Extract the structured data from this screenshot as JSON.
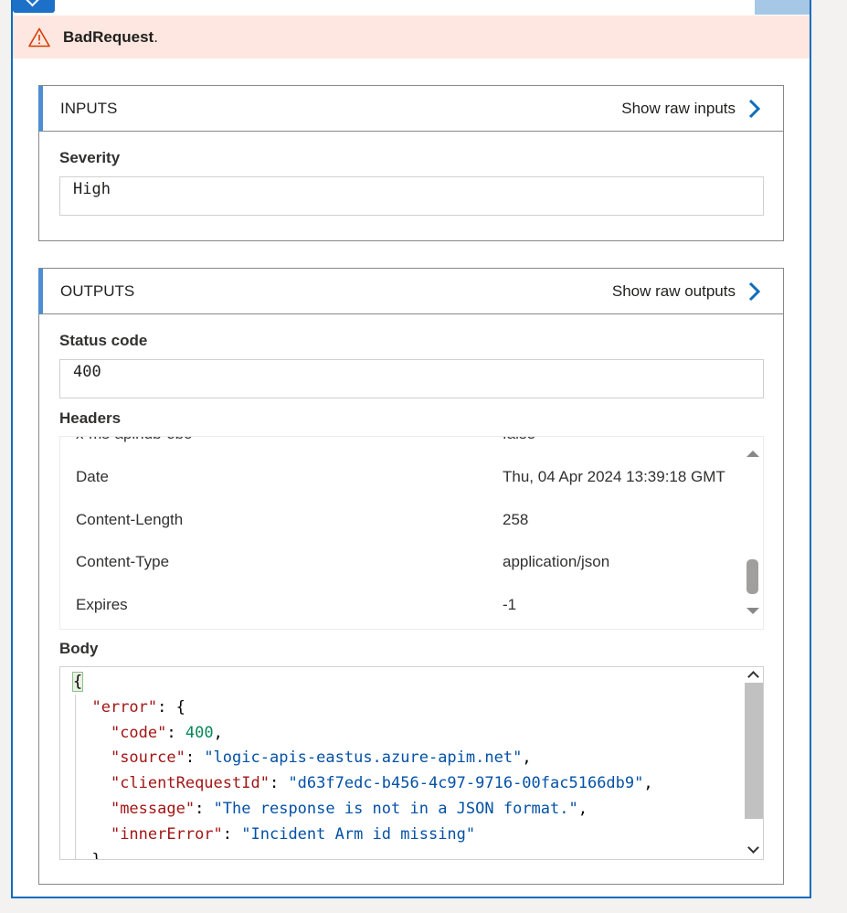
{
  "error_banner": {
    "title": "BadRequest",
    "suffix": ".",
    "icon": "warning-triangle-icon",
    "color": "#fde7e0"
  },
  "inputs": {
    "title": "INPUTS",
    "raw_link": "Show raw inputs",
    "fields": {
      "severity_label": "Severity",
      "severity_value": "High"
    }
  },
  "outputs": {
    "title": "OUTPUTS",
    "raw_link": "Show raw outputs",
    "status_code_label": "Status code",
    "status_code_value": "400",
    "headers_label": "Headers",
    "headers": [
      {
        "name": "x-ms-apihub-obo",
        "value": "false"
      },
      {
        "name": "Date",
        "value": "Thu, 04 Apr 2024 13:39:18 GMT"
      },
      {
        "name": "Content-Length",
        "value": "258"
      },
      {
        "name": "Content-Type",
        "value": "application/json"
      },
      {
        "name": "Expires",
        "value": "-1"
      }
    ],
    "body_label": "Body",
    "body_lines": {
      "l1": "{",
      "l2_key": "\"error\"",
      "l2_rest": ": {",
      "l3_key": "\"code\"",
      "l3_val": "400",
      "l4_key": "\"source\"",
      "l4_val": "\"logic-apis-eastus.azure-apim.net\"",
      "l5_key": "\"clientRequestId\"",
      "l5_val": "\"d63f7edc-b456-4c97-9716-00fac5166db9\"",
      "l6_key": "\"message\"",
      "l6_val": "\"The response is not in a JSON format.\"",
      "l7_key": "\"innerError\"",
      "l7_val": "\"Incident Arm id missing\"",
      "l8": "}"
    }
  },
  "colors": {
    "accent": "#0f6cbd",
    "section_bar": "#4c8ed3",
    "json_key": "#a31515",
    "json_string": "#0451a5",
    "json_number": "#098658"
  }
}
